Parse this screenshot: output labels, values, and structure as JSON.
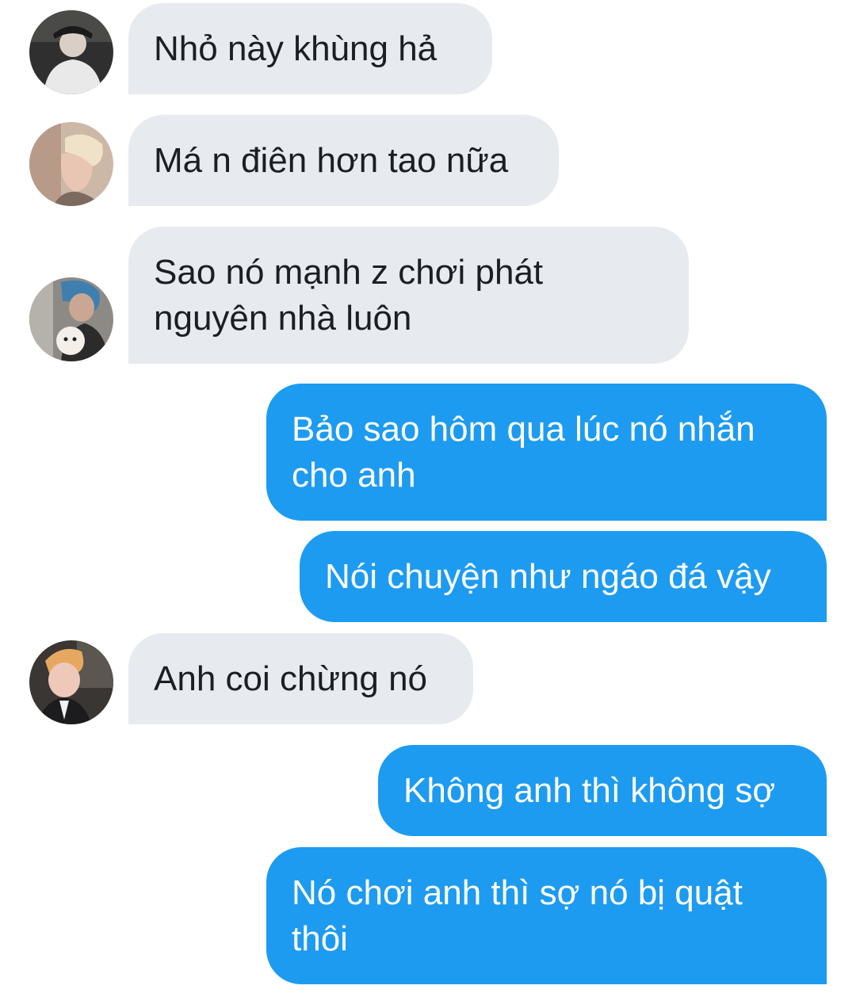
{
  "conversation": {
    "messages": [
      {
        "direction": "incoming",
        "text": "Nhỏ này khùng hả",
        "avatar_icon": "user-avatar-icon"
      },
      {
        "direction": "incoming",
        "text": "Má n điên hơn tao nữa",
        "avatar_icon": "user-avatar-icon"
      },
      {
        "direction": "incoming",
        "text": "Sao nó mạnh z chơi phát nguyên nhà luôn",
        "avatar_icon": "user-avatar-icon"
      },
      {
        "direction": "outgoing",
        "text": "Bảo sao hôm qua lúc nó nhắn cho anh"
      },
      {
        "direction": "outgoing",
        "text": "Nói chuyện như ngáo đá vậy"
      },
      {
        "direction": "incoming",
        "text": "Anh coi chừng nó",
        "avatar_icon": "user-avatar-icon"
      },
      {
        "direction": "outgoing",
        "text": "Không anh thì không sợ"
      },
      {
        "direction": "outgoing",
        "text": "Nó chơi anh thì sợ nó bị quật thôi"
      }
    ]
  },
  "colors": {
    "incoming_bubble": "#e7eaee",
    "incoming_text": "#1b1f23",
    "outgoing_bubble": "#1d9bf0",
    "outgoing_text": "#ffffff",
    "background": "#ffffff"
  }
}
